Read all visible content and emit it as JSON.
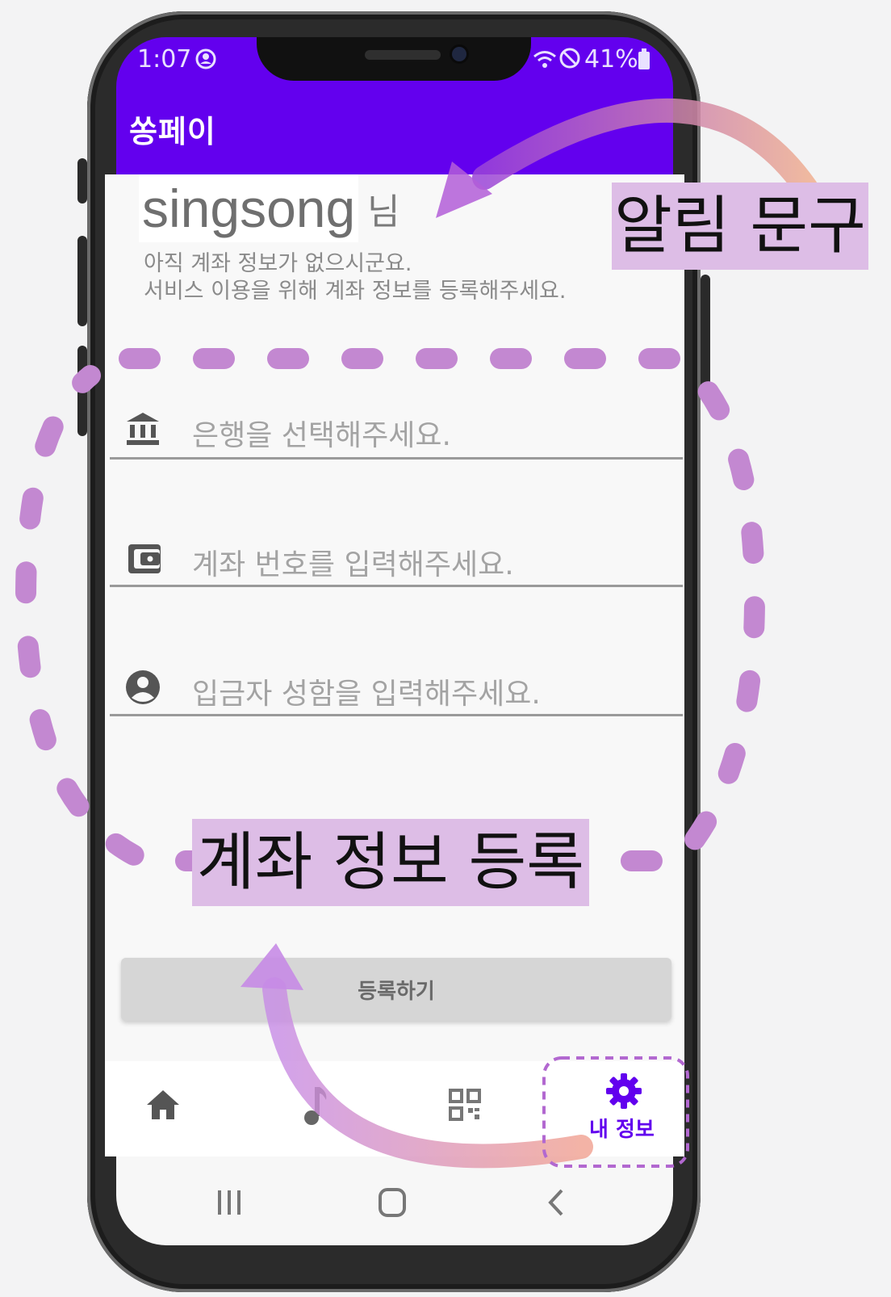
{
  "status_bar": {
    "time": "1:07",
    "battery": "41%"
  },
  "app": {
    "title": "쏭페이"
  },
  "greeting": {
    "name": "singsong",
    "suffix": "님"
  },
  "notice": {
    "line1": "아직 계좌 정보가 없으시군요.",
    "line2": "서비스 이용을 위해 계좌 정보를 등록해주세요."
  },
  "form": {
    "fields": [
      {
        "icon": "bank-icon",
        "placeholder": "은행을 선택해주세요."
      },
      {
        "icon": "wallet-icon",
        "placeholder": "계좌 번호를 입력해주세요."
      },
      {
        "icon": "account-circle-icon",
        "placeholder": "입금자 성함을 입력해주세요."
      }
    ],
    "submit_label": "등록하기"
  },
  "bottom_nav": {
    "items": [
      {
        "icon": "home-icon",
        "label": ""
      },
      {
        "icon": "music-note-icon",
        "label": ""
      },
      {
        "icon": "qr-code-icon",
        "label": ""
      },
      {
        "icon": "gear-icon",
        "label": "내 정보",
        "active": true
      }
    ]
  },
  "annotations": {
    "notice_label": "알림 문구",
    "form_label": "계좌 정보 등록"
  },
  "colors": {
    "app_bar": "#6300ee",
    "accent": "#6200ee",
    "annotation": "#c388d1",
    "annotation_label_bg": "#ddbde6"
  }
}
